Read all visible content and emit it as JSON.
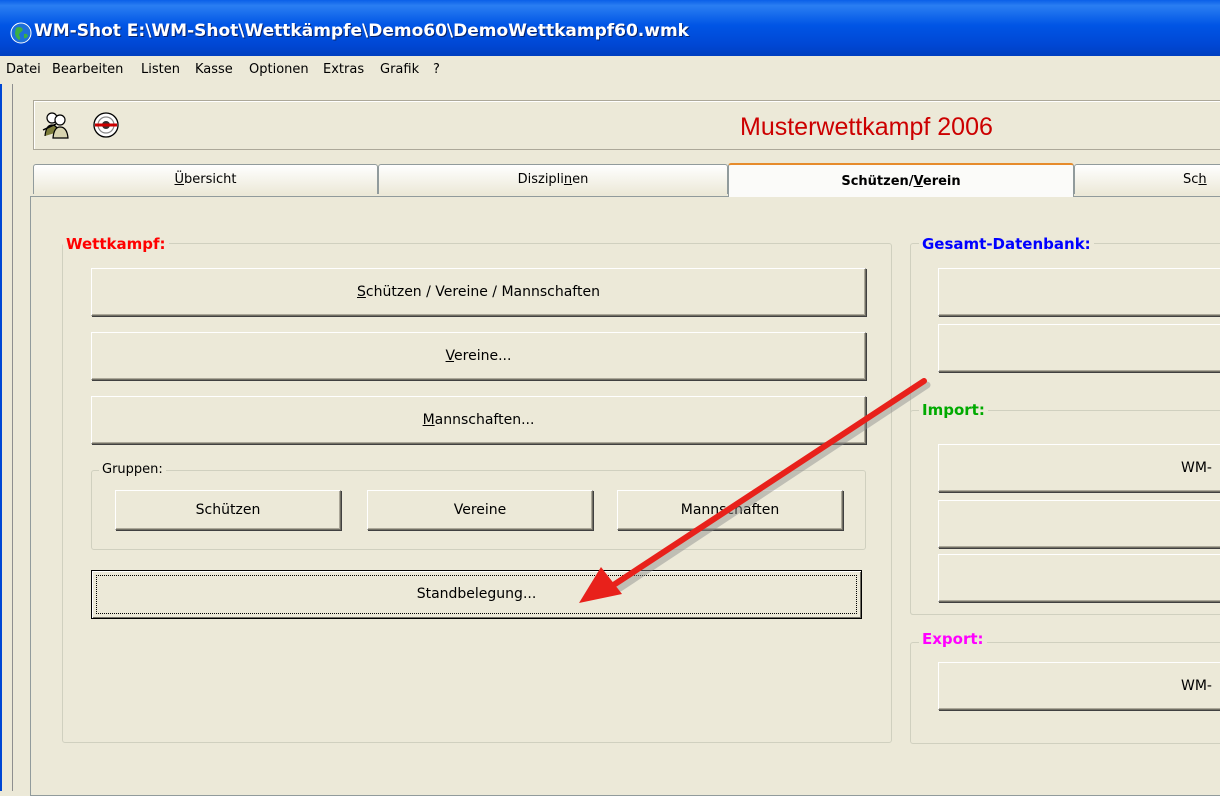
{
  "window": {
    "title": "WM-Shot E:\\WM-Shot\\Wettkämpfe\\Demo60\\DemoWettkampf60.wmk"
  },
  "menu": {
    "items": [
      {
        "label": "Datei"
      },
      {
        "label": "Bearbeiten"
      },
      {
        "label": "Listen"
      },
      {
        "label": "Kasse"
      },
      {
        "label": "Optionen"
      },
      {
        "label": "Extras"
      },
      {
        "label": "Grafik"
      },
      {
        "label": "?"
      }
    ]
  },
  "header": {
    "contest_title": "Musterwettkampf 2006",
    "title_color": "#cc0000",
    "icons": [
      "shooter-icon",
      "target-icon"
    ]
  },
  "tabs": [
    {
      "pre": "",
      "key": "Ü",
      "post": "bersicht",
      "active": false
    },
    {
      "pre": "Diszipli",
      "key": "n",
      "post": "en",
      "active": false
    },
    {
      "pre": "Schützen/",
      "key": "V",
      "post": "erein",
      "active": true
    },
    {
      "pre": "Sc",
      "key": "h",
      "post": "",
      "active": false
    }
  ],
  "wettkampf": {
    "label": "Wettkampf:",
    "label_color": "#ff0000",
    "btn_schuetzen": {
      "pre": "",
      "key": "S",
      "post": "chützen / Vereine / Mannschaften"
    },
    "btn_vereine": {
      "pre": "",
      "key": "V",
      "post": "ereine..."
    },
    "btn_mannschaften": {
      "pre": "",
      "key": "M",
      "post": "annschaften..."
    },
    "gruppen": {
      "label": "Gruppen:",
      "btn_schuetzen": "Schützen",
      "btn_vereine": "Vereine",
      "btn_mannschaften": "Mannschaften"
    },
    "btn_standbelegung": "Standbelegung..."
  },
  "gesamt": {
    "label": "Gesamt-Datenbank:",
    "label_color": "#0000ff"
  },
  "import": {
    "label": "Import:",
    "label_color": "#00aa00",
    "btn1": "WM-"
  },
  "export": {
    "label": "Export:",
    "label_color": "#ff00ff",
    "btn1": "WM-"
  },
  "annotation": {
    "arrow_color": "#e8211b"
  }
}
